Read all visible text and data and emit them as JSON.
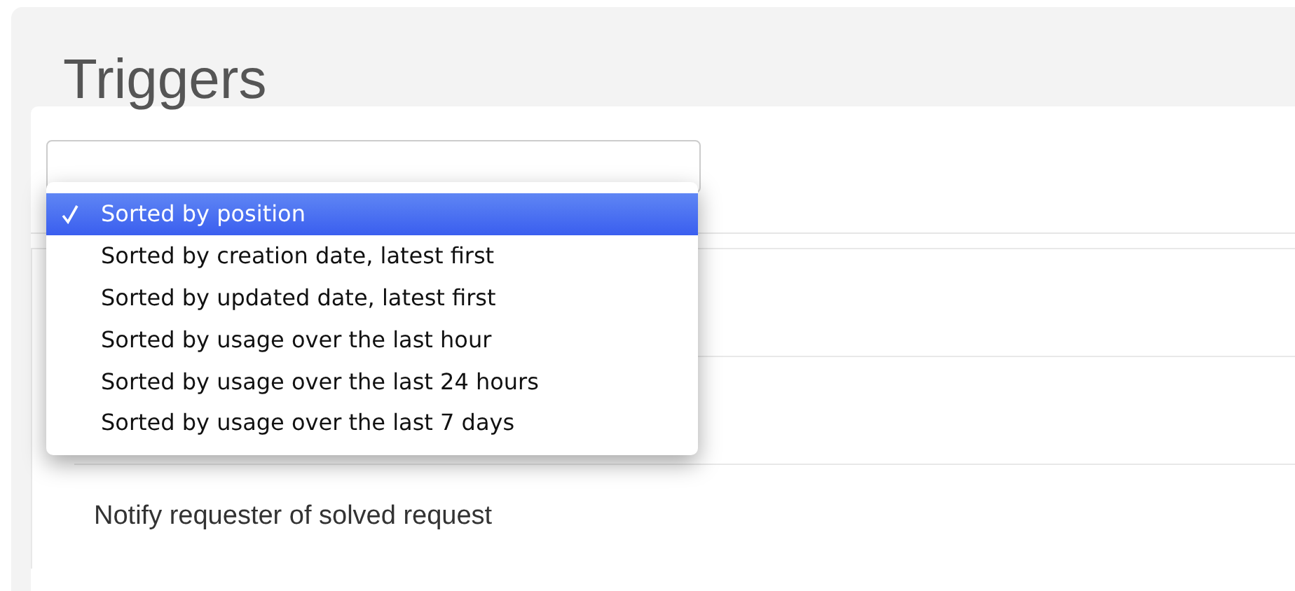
{
  "page": {
    "title": "Triggers"
  },
  "sort_menu": {
    "options": [
      {
        "label": "Sorted by position",
        "selected": true
      },
      {
        "label": "Sorted by creation date, latest first",
        "selected": false
      },
      {
        "label": "Sorted by updated date, latest first",
        "selected": false
      },
      {
        "label": "Sorted by usage over the last hour",
        "selected": false
      },
      {
        "label": "Sorted by usage over the last 24 hours",
        "selected": false
      },
      {
        "label": "Sorted by usage over the last 7 days",
        "selected": false
      }
    ]
  },
  "triggers": {
    "rows": [
      {
        "title": "Notify requester of solved request"
      }
    ]
  }
}
